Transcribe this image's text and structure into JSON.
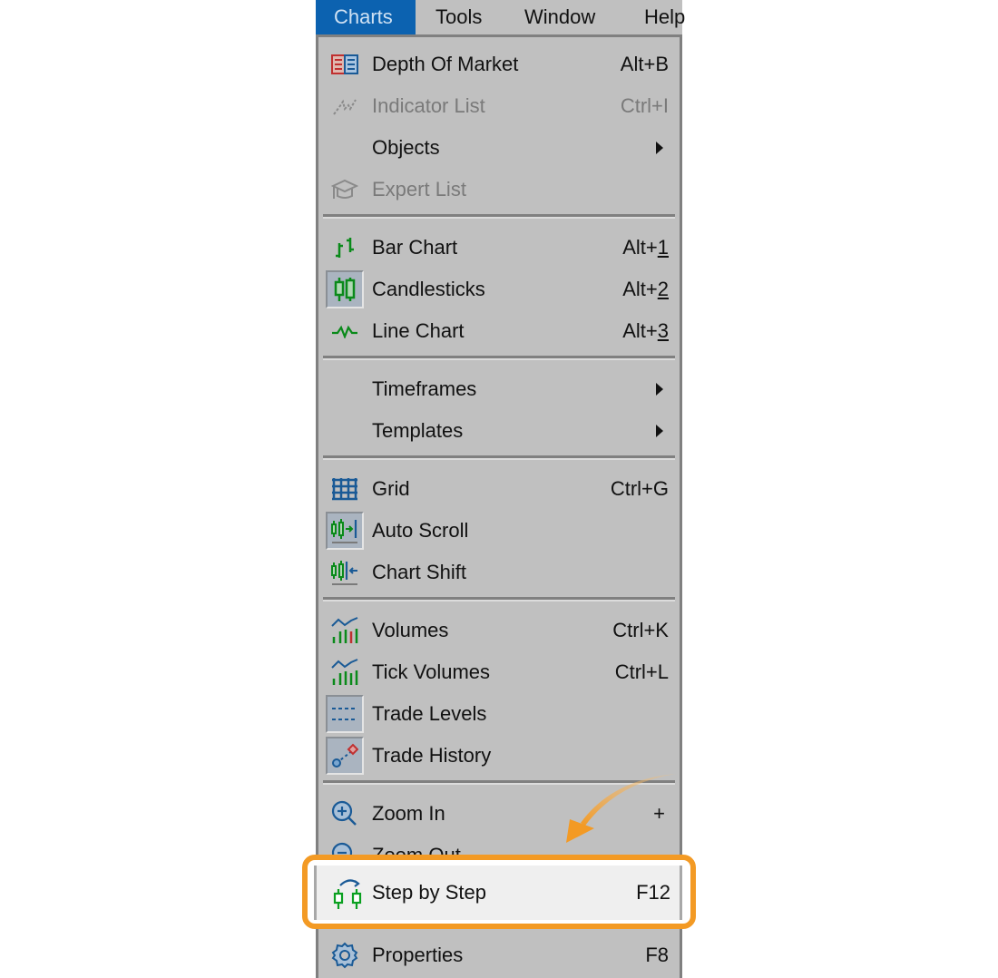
{
  "menubar": {
    "items": [
      {
        "label": "Charts",
        "active": true
      },
      {
        "label": "Tools"
      },
      {
        "label": "Window"
      },
      {
        "label": "Help"
      }
    ]
  },
  "menu": {
    "items": {
      "depth_of_market": {
        "label": "Depth Of Market",
        "shortcut": "Alt+B",
        "icon": "depth-of-market-icon"
      },
      "indicator_list": {
        "label": "Indicator List",
        "shortcut": "Ctrl+I",
        "icon": "indicator-list-icon",
        "disabled": true
      },
      "objects": {
        "label": "Objects",
        "submenu": true
      },
      "expert_list": {
        "label": "Expert List",
        "icon": "graduation-cap-icon",
        "disabled": true
      },
      "bar_chart": {
        "label": "Bar Chart",
        "shortcut_prefix": "Alt+",
        "shortcut_key": "1",
        "icon": "bar-chart-icon"
      },
      "candlesticks": {
        "label": "Candlesticks",
        "shortcut_prefix": "Alt+",
        "shortcut_key": "2",
        "icon": "candlesticks-icon",
        "checked": true
      },
      "line_chart": {
        "label": "Line Chart",
        "shortcut_prefix": "Alt+",
        "shortcut_key": "3",
        "icon": "line-chart-icon"
      },
      "timeframes": {
        "label": "Timeframes",
        "submenu": true
      },
      "templates": {
        "label": "Templates",
        "submenu": true
      },
      "grid": {
        "label": "Grid",
        "shortcut": "Ctrl+G",
        "icon": "grid-icon"
      },
      "auto_scroll": {
        "label": "Auto Scroll",
        "icon": "auto-scroll-icon",
        "checked": true
      },
      "chart_shift": {
        "label": "Chart Shift",
        "icon": "chart-shift-icon"
      },
      "volumes": {
        "label": "Volumes",
        "shortcut": "Ctrl+K",
        "icon": "volumes-icon"
      },
      "tick_volumes": {
        "label": "Tick Volumes",
        "shortcut": "Ctrl+L",
        "icon": "tick-volumes-icon"
      },
      "trade_levels": {
        "label": "Trade Levels",
        "icon": "trade-levels-icon",
        "checked": true
      },
      "trade_history": {
        "label": "Trade History",
        "icon": "trade-history-icon",
        "checked": true
      },
      "zoom_in": {
        "label": "Zoom In",
        "shortcut": "+",
        "icon": "zoom-in-icon"
      },
      "zoom_out": {
        "label": "Zoom Out",
        "icon": "zoom-out-icon"
      },
      "step_by_step": {
        "label": "Step by Step",
        "shortcut": "F12",
        "icon": "step-by-step-icon",
        "highlighted": true
      },
      "properties": {
        "label": "Properties",
        "shortcut": "F8",
        "icon": "gear-icon"
      }
    }
  },
  "annotation": {
    "highlight_color": "#f39a24",
    "target": "Step by Step"
  },
  "colors": {
    "menu_bg": "#c0c0c0",
    "active_menu": "#0c62b0",
    "green": "#0a8a1a",
    "blue": "#1a5a96",
    "red": "#c03030"
  }
}
